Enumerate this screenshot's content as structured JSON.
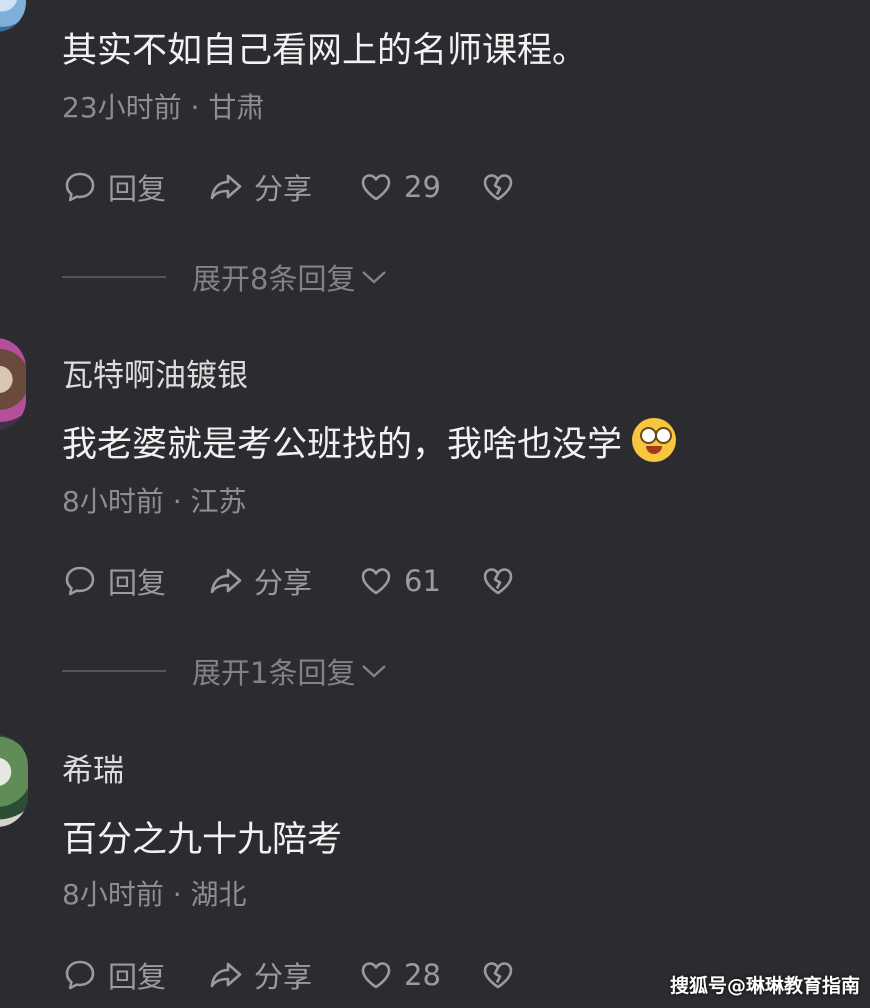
{
  "comments": [
    {
      "name": "",
      "text": "其实不如自己看网上的名师课程。",
      "meta": "23小时前 · 甘肃",
      "reply_label": "回复",
      "share_label": "分享",
      "likes": "29",
      "expand_label": "展开8条回复"
    },
    {
      "name": "瓦特啊油镀银",
      "text": "我老婆就是考公班找的，我啥也没学",
      "meta": "8小时前 · 江苏",
      "reply_label": "回复",
      "share_label": "分享",
      "likes": "61",
      "expand_label": "展开1条回复"
    },
    {
      "name": "希瑞",
      "text": "百分之九十九陪考",
      "meta": "8小时前 · 湖北",
      "reply_label": "回复",
      "share_label": "分享",
      "likes": "28"
    }
  ],
  "icons": {
    "reply": "comment-bubble-icon",
    "share": "share-arrow-icon",
    "like": "heart-outline-icon",
    "dislike": "broken-heart-icon",
    "expand": "chevron-down-icon"
  },
  "watermark": "搜狐号@琳琳教育指南"
}
